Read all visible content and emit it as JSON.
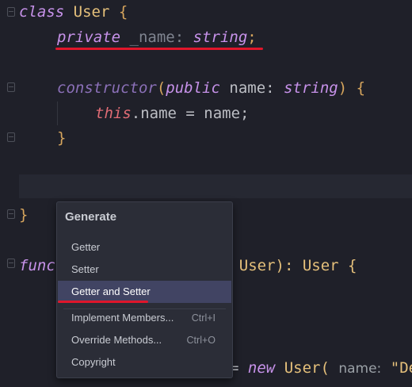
{
  "code": {
    "line1": {
      "kw": "class",
      "name": "User",
      "brace": "{"
    },
    "line2": {
      "mod": "private",
      "ident": "_name",
      "colon": ":",
      "type": "string",
      "semi": ";"
    },
    "line4": {
      "kw": "constructor",
      "open": "(",
      "mod": "public",
      "ident": "name",
      "colon": ":",
      "type": "string",
      "close": ")",
      "brace": "{"
    },
    "line5": {
      "this": "this",
      "rest": ".name = name;"
    },
    "line6": {
      "brace": "}"
    },
    "line8": {
      "brace": "}"
    },
    "line10": {
      "kw": "func",
      "tail": "er: User): User {"
    },
    "line14": {
      "op": "=",
      "kw": "new",
      "type": "User(",
      "hint": "name:",
      "str": "\"De"
    }
  },
  "popup": {
    "title": "Generate",
    "items": [
      {
        "label": "Getter",
        "shortcut": ""
      },
      {
        "label": "Setter",
        "shortcut": ""
      },
      {
        "label": "Getter and Setter",
        "shortcut": "",
        "selected": true
      },
      {
        "label": "Implement Members...",
        "shortcut": "Ctrl+I"
      },
      {
        "label": "Override Methods...",
        "shortcut": "Ctrl+O"
      },
      {
        "label": "Copyright",
        "shortcut": ""
      }
    ]
  }
}
